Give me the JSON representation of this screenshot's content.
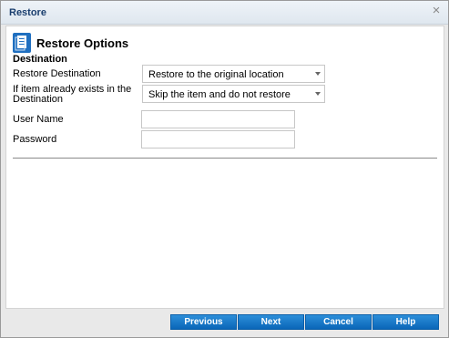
{
  "dialog": {
    "title": "Restore"
  },
  "options": {
    "heading": "Restore Options",
    "section_title": "Destination",
    "restore_destination": {
      "label": "Restore Destination",
      "value": "Restore to the original location"
    },
    "if_exists": {
      "label_line1": "If item already exists in the",
      "label_line2": "Destination",
      "value": "Skip the item and do not restore"
    },
    "user_name": {
      "label": "User Name",
      "value": ""
    },
    "password": {
      "label": "Password",
      "value": ""
    }
  },
  "buttons": {
    "previous": "Previous",
    "next": "Next",
    "cancel": "Cancel",
    "help": "Help"
  },
  "icons": {
    "close": "close-icon",
    "options": "document-icon"
  }
}
